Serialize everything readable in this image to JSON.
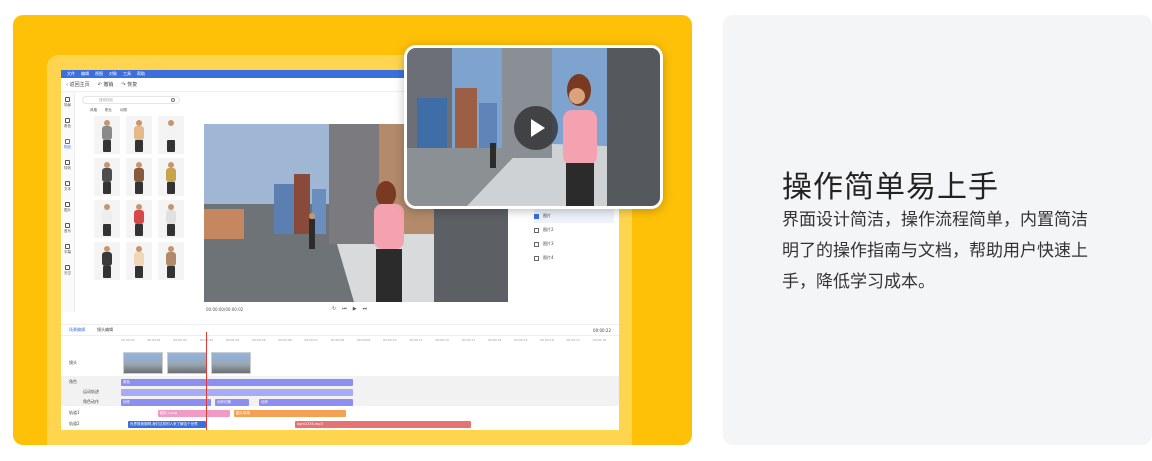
{
  "editor": {
    "menu": [
      "文件",
      "编辑",
      "视图",
      "对象",
      "工具",
      "帮助"
    ],
    "toolbar": {
      "back": "返回主页",
      "undo": "撤销",
      "redo": "恢复"
    },
    "sidebar": [
      {
        "label": "场景",
        "active": false
      },
      {
        "label": "角色",
        "active": false
      },
      {
        "label": "物品",
        "active": true
      },
      {
        "label": "特效",
        "active": false
      },
      {
        "label": "文本",
        "active": false
      },
      {
        "label": "图片",
        "active": false
      },
      {
        "label": "音乐",
        "active": false
      },
      {
        "label": "字幕",
        "active": false
      },
      {
        "label": "天空",
        "active": false
      }
    ],
    "search_placeholder": "搜索物品",
    "filters": [
      "风格",
      "职业",
      "动物"
    ],
    "preview_timecode": "00:00:00/00:00:02",
    "layers": [
      {
        "label": "图片",
        "selected": true
      },
      {
        "label": "图片2",
        "selected": false
      },
      {
        "label": "图片3",
        "selected": false
      },
      {
        "label": "图片4",
        "selected": false
      }
    ],
    "timeline_tabs": [
      "场景编辑",
      "镜头编辑"
    ],
    "timeline_zoom": "00:00:22",
    "ruler": [
      "00:00:00",
      "00:00:01",
      "00:00:02",
      "00:00:03",
      "00:00:04",
      "00:00:05",
      "00:00:06",
      "00:00:07",
      "00:00:08",
      "00:00:09",
      "00:00:10",
      "00:00:11",
      "00:00:12",
      "00:00:13",
      "00:00:14",
      "00:00:15",
      "00:00:16",
      "00:00:17",
      "00:00:18"
    ],
    "tracks": [
      {
        "label": "镜头"
      },
      {
        "label": "角色"
      },
      {
        "label": "运动轨迹"
      },
      {
        "label": "角色动作"
      },
      {
        "label": "轨道1"
      },
      {
        "label": "轨道2"
      }
    ],
    "clips": {
      "role": "角色",
      "action1": "动作",
      "action2": "动作切换",
      "action3": "动作",
      "img1": "图片1.png",
      "img2": "图片效果",
      "text1": "世界很美丽啊,我们这样的人来了解这个世界",
      "audio1": "bgm1234.mp3"
    }
  },
  "feature": {
    "title": "操作简单易上手",
    "description": "界面设计简洁，操作流程简单，内置简洁明了的操作指南与文档，帮助用户快速上手，降低学习成本。"
  },
  "colors": {
    "yellow": "#FFC107",
    "accent": "#3b6fe0",
    "gray_card": "#F4F5F7"
  }
}
